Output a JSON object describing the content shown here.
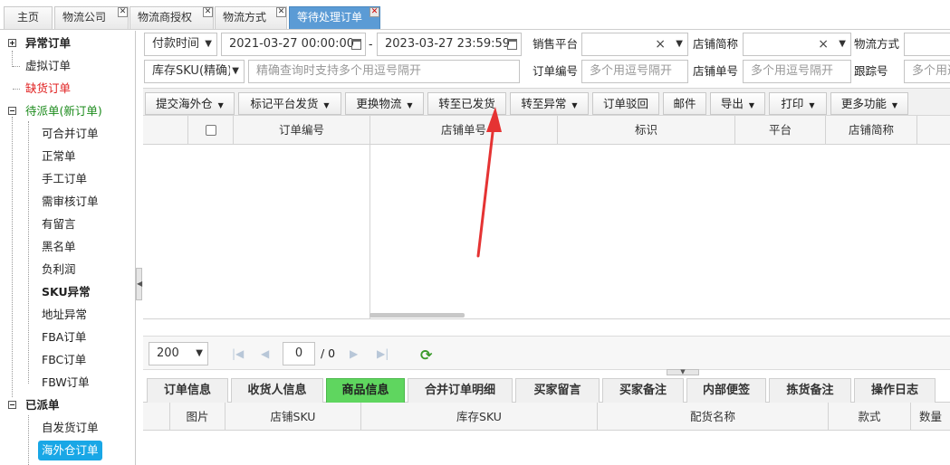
{
  "top_tabs": [
    {
      "label": "主页"
    },
    {
      "label": "物流公司"
    },
    {
      "label": "物流商授权"
    },
    {
      "label": "物流方式"
    },
    {
      "label": "等待处理订单"
    }
  ],
  "sidebar": {
    "groups": {
      "exception": "异常订单",
      "pending": "待派单(新订单)",
      "dispatched": "已派单"
    },
    "items": {
      "virtual": "虚拟订单",
      "out_of_stock": "缺货订单",
      "mergeable": "可合并订单",
      "normal": "正常单",
      "manual": "手工订单",
      "needs_review": "需审核订单",
      "has_message": "有留言",
      "blacklist": "黑名单",
      "negative_profit": "负利润",
      "sku_exception": "SKU异常",
      "address_exception": "地址异常",
      "fba": "FBA订单",
      "fbc": "FBC订单",
      "fbw": "FBW订单",
      "self_ship": "自发货订单",
      "overseas": "海外仓订单"
    }
  },
  "filters": {
    "time_type": "付款时间",
    "date_start": "2021-03-27 00:00:00",
    "date_sep": "-",
    "date_end": "2023-03-27 23:59:59",
    "sales_platform_label": "销售平台",
    "shop_abbr_label": "店铺简称",
    "logistics_label": "物流方式",
    "sku_type": "库存SKU(精确)",
    "sku_placeholder": "精确查询时支持多个用逗号隔开",
    "order_no_label": "订单编号",
    "order_no_placeholder": "多个用逗号隔开",
    "shop_order_label": "店铺单号",
    "shop_order_placeholder": "多个用逗号隔开",
    "tracking_label": "跟踪号",
    "tracking_placeholder": "多个用逗号隔开"
  },
  "toolbar": {
    "submit_overseas": "提交海外仓",
    "mark_platform": "标记平台发货",
    "change_logistics": "更换物流",
    "to_shipped": "转至已发货",
    "to_exception": "转至异常",
    "reject": "订单驳回",
    "mail": "邮件",
    "export": "导出",
    "print": "打印",
    "more": "更多功能"
  },
  "grid": {
    "columns": [
      "订单编号",
      "店铺单号",
      "标识",
      "平台",
      "店铺简称"
    ]
  },
  "pager": {
    "page_size": "200",
    "current_page": "0",
    "total_label": "/ 0"
  },
  "bottom_tabs": [
    {
      "label": "订单信息"
    },
    {
      "label": "收货人信息"
    },
    {
      "label": "商品信息"
    },
    {
      "label": "合并订单明细"
    },
    {
      "label": "买家留言"
    },
    {
      "label": "买家备注"
    },
    {
      "label": "内部便签"
    },
    {
      "label": "拣货备注"
    },
    {
      "label": "操作日志"
    }
  ],
  "bottom_grid": {
    "columns": [
      "图片",
      "店铺SKU",
      "库存SKU",
      "配货名称",
      "款式",
      "数量"
    ]
  },
  "colors": {
    "active_tab": "#5b9bd5",
    "active_bottom_tab": "#5fd65f",
    "annotation_arrow": "#e53333",
    "selected_item": "#19a7e6"
  }
}
